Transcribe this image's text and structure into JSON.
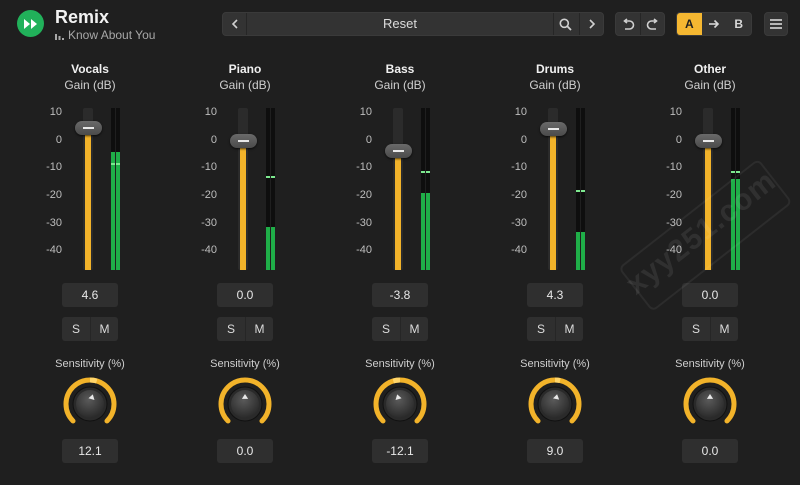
{
  "header": {
    "app_title": "Remix",
    "song_title": "Know About You",
    "preset_name": "Reset",
    "ab": {
      "a_label": "A",
      "b_label": "B",
      "active": "A"
    }
  },
  "colors": {
    "accent": "#f5b731",
    "fader_fill": "#f2b32a",
    "meter": "#1fae48",
    "logo": "#21b15a",
    "background": "#1f1f1f"
  },
  "scale_ticks": [
    "10",
    "0",
    "-10",
    "-20",
    "-30",
    "-40"
  ],
  "channels": [
    {
      "name": "Vocals",
      "unit_label": "Gain (dB)",
      "gain": "4.6",
      "gain_db": 4.6,
      "meter_db": -4,
      "peak_db": -8,
      "solo_label": "S",
      "mute_label": "M",
      "sensitivity_label": "Sensitivity (%)",
      "sensitivity": "12.1",
      "sensitivity_value": 12.1
    },
    {
      "name": "Piano",
      "unit_label": "Gain (dB)",
      "gain": "0.0",
      "gain_db": 0.0,
      "meter_db": -31,
      "peak_db": -13,
      "solo_label": "S",
      "mute_label": "M",
      "sensitivity_label": "Sensitivity (%)",
      "sensitivity": "0.0",
      "sensitivity_value": 0.0
    },
    {
      "name": "Bass",
      "unit_label": "Gain (dB)",
      "gain": "-3.8",
      "gain_db": -3.8,
      "meter_db": -19,
      "peak_db": -11,
      "solo_label": "S",
      "mute_label": "M",
      "sensitivity_label": "Sensitivity (%)",
      "sensitivity": "-12.1",
      "sensitivity_value": -12.1
    },
    {
      "name": "Drums",
      "unit_label": "Gain (dB)",
      "gain": "4.3",
      "gain_db": 4.3,
      "meter_db": -33,
      "peak_db": -18,
      "solo_label": "S",
      "mute_label": "M",
      "sensitivity_label": "Sensitivity (%)",
      "sensitivity": "9.0",
      "sensitivity_value": 9.0
    },
    {
      "name": "Other",
      "unit_label": "Gain (dB)",
      "gain": "0.0",
      "gain_db": 0.0,
      "meter_db": -14,
      "peak_db": -11,
      "solo_label": "S",
      "mute_label": "M",
      "sensitivity_label": "Sensitivity (%)",
      "sensitivity": "0.0",
      "sensitivity_value": 0.0
    }
  ],
  "watermark": "xyy251.com"
}
